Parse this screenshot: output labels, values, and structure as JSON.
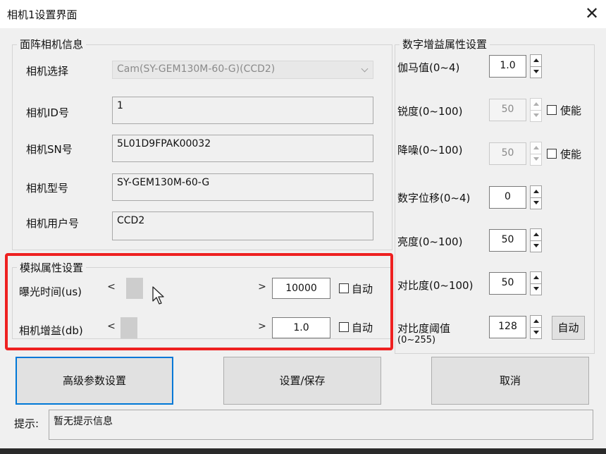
{
  "window": {
    "title": "相机1设置界面"
  },
  "camera_info": {
    "group_label": "面阵相机信息",
    "camera_select_label": "相机选择",
    "camera_select_value": "Cam(SY-GEM130M-60-G)(CCD2)",
    "id_label": "相机ID号",
    "id_value": "1",
    "sn_label": "相机SN号",
    "sn_value": "5L01D9FPAK00032",
    "model_label": "相机型号",
    "model_value": "SY-GEM130M-60-G",
    "user_id_label": "相机用户号",
    "user_id_value": "CCD2"
  },
  "analog": {
    "group_label": "模拟属性设置",
    "exposure_label": "曝光时间(us)",
    "exposure_value": "10000",
    "exposure_auto_label": "自动",
    "gain_label": "相机增益(db)",
    "gain_value": "1.0",
    "gain_auto_label": "自动",
    "left_arrow": "<",
    "right_arrow": ">"
  },
  "digital": {
    "group_label": "数字增益属性设置",
    "gamma_label": "伽马值(0~4)",
    "gamma_value": "1.0",
    "sharpness_label": "锐度(0~100)",
    "sharpness_value": "50",
    "sharpness_enable_label": "使能",
    "noise_label": "降噪(0~100)",
    "noise_value": "50",
    "noise_enable_label": "使能",
    "digital_shift_label": "数字位移(0~4)",
    "digital_shift_value": "0",
    "brightness_label": "亮度(0~100)",
    "brightness_value": "50",
    "contrast_label": "对比度(0~100)",
    "contrast_value": "50",
    "contrast_threshold_label": "对比度阈值",
    "contrast_threshold_range": "(0~255)",
    "contrast_threshold_value": "128",
    "auto_button_label": "自动"
  },
  "buttons": {
    "advanced_label": "高级参数设置",
    "save_label": "设置/保存",
    "cancel_label": "取消"
  },
  "hint": {
    "label": "提示:",
    "value": "暂无提示信息"
  },
  "colors": {
    "highlight_border": "#ee2020",
    "focused_button_border": "#0078d7"
  }
}
